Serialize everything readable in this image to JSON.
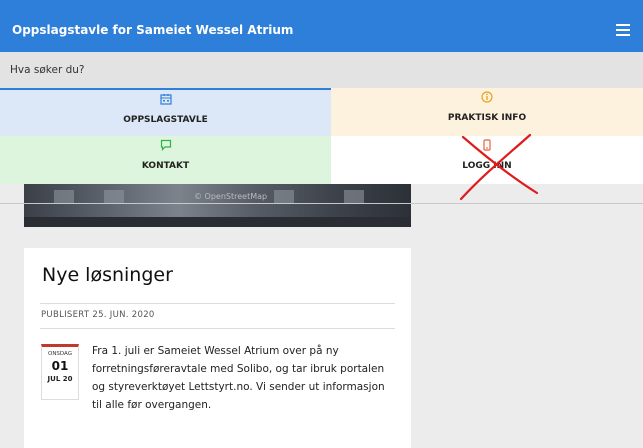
{
  "header": {
    "title": "Oppslagstavle for Sameiet Wessel Atrium",
    "menu_icon": "hamburger-icon"
  },
  "search": {
    "placeholder": "Hva søker du?"
  },
  "nav": {
    "items": [
      {
        "label": "OPPSLAGSTAVLE",
        "icon": "calendar-icon",
        "color": "#2d7fd9",
        "active": true
      },
      {
        "label": "PRAKTISK INFO",
        "icon": "info-icon",
        "color": "#e8a21b"
      },
      {
        "label": "KONTAKT",
        "icon": "chat-icon",
        "color": "#2fb14a"
      },
      {
        "label": "LOGG INN",
        "icon": "phone-icon",
        "color": "#e8613a",
        "crossed_out": true
      }
    ]
  },
  "hero": {
    "watermark": "© OpenStreetMap"
  },
  "post": {
    "title": "Nye løsninger",
    "published": "PUBLISERT 25. JUN. 2020",
    "date_badge": {
      "weekday": "ONSDAG",
      "day": "01",
      "month": "JUL 20"
    },
    "body": "Fra 1. juli er Sameiet Wessel Atrium over på ny forretningsføreravtale med Solibo, og tar ibruk portalen og styreverktøyet Lettstyrt.no. Vi sender ut informasjon til alle før overgangen."
  }
}
